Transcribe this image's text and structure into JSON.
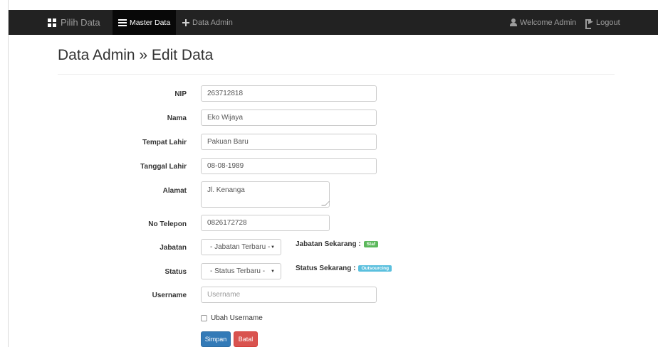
{
  "navbar": {
    "brand": "Pilih Data",
    "items": [
      {
        "label": "Master Data",
        "active": true
      },
      {
        "label": "Data Admin",
        "active": false
      }
    ],
    "welcome": "Welcome Admin",
    "logout": "Logout"
  },
  "page": {
    "title": "Data Admin » Edit Data"
  },
  "form": {
    "nip": {
      "label": "NIP",
      "value": "263712818"
    },
    "nama": {
      "label": "Nama",
      "value": "Eko Wijaya"
    },
    "tempat_lahir": {
      "label": "Tempat Lahir",
      "value": "Pakuan Baru"
    },
    "tanggal_lahir": {
      "label": "Tanggal Lahir",
      "value": "08-08-1989"
    },
    "alamat": {
      "label": "Alamat",
      "value": "Jl. Kenanga"
    },
    "no_telepon": {
      "label": "No Telepon",
      "value": "0826172728"
    },
    "jabatan": {
      "label": "Jabatan",
      "selected": "- Jabatan Terbaru -",
      "current_label": "Jabatan Sekarang :",
      "current_value": "Staf"
    },
    "status": {
      "label": "Status",
      "selected": "- Status Terbaru -",
      "current_label": "Status Sekarang :",
      "current_value": "Outsourcing"
    },
    "username": {
      "label": "Username",
      "placeholder": "Username"
    },
    "ubah_username": {
      "label": "Ubah Username",
      "checked": false
    },
    "buttons": {
      "save": "Simpan",
      "cancel": "Batal"
    }
  },
  "colors": {
    "navbar_bg": "#222222",
    "primary": "#337ab7",
    "danger": "#d9534f",
    "badge_success": "#5cb85c",
    "badge_info": "#5bc0de"
  }
}
